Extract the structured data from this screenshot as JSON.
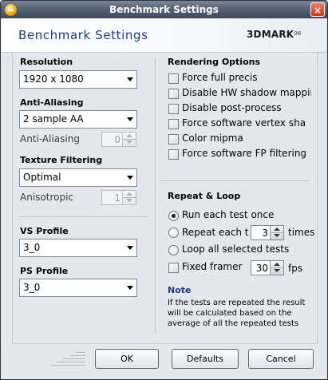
{
  "window": {
    "title": "Benchmark Settings",
    "close_label": "×"
  },
  "header": {
    "heading": "Benchmark Settings",
    "logo_text": "3DMARK",
    "logo_suffix": "06"
  },
  "left": {
    "resolution": {
      "label": "Resolution",
      "value": "1920 x 1080"
    },
    "anti_aliasing": {
      "label": "Anti-Aliasing",
      "value": "2 sample AA",
      "spin_label": "Anti-Aliasing",
      "spin_value": "0"
    },
    "texture_filtering": {
      "label": "Texture Filtering",
      "value": "Optimal",
      "spin_label": "Anisotropic",
      "spin_value": "1"
    },
    "vs_profile": {
      "label": "VS Profile",
      "value": "3_0"
    },
    "ps_profile": {
      "label": "PS Profile",
      "value": "3_0"
    }
  },
  "rendering": {
    "title": "Rendering Options",
    "options": [
      "Force full precis",
      "Disable HW shadow mapping",
      "Disable post-process",
      "Force software vertex sha",
      "Color mipma",
      "Force software FP filtering"
    ]
  },
  "repeat": {
    "title": "Repeat & Loop",
    "run_once": "Run each test once",
    "repeat_label": "Repeat each t",
    "repeat_value": "3",
    "repeat_suffix": "times",
    "loop_label": "Loop all selected tests",
    "fixed_label": "Fixed framer",
    "fixed_value": "30",
    "fixed_suffix": "fps"
  },
  "note": {
    "title": "Note",
    "text": "If the tests are repeated the result will be calculated based on the average of all the repeated tests"
  },
  "buttons": {
    "ok": "OK",
    "defaults": "Defaults",
    "cancel": "Cancel"
  },
  "colors": {
    "heading": "#1c3b89",
    "titlebar": "#4b5668",
    "panel_bg": "#e4e8ec"
  }
}
